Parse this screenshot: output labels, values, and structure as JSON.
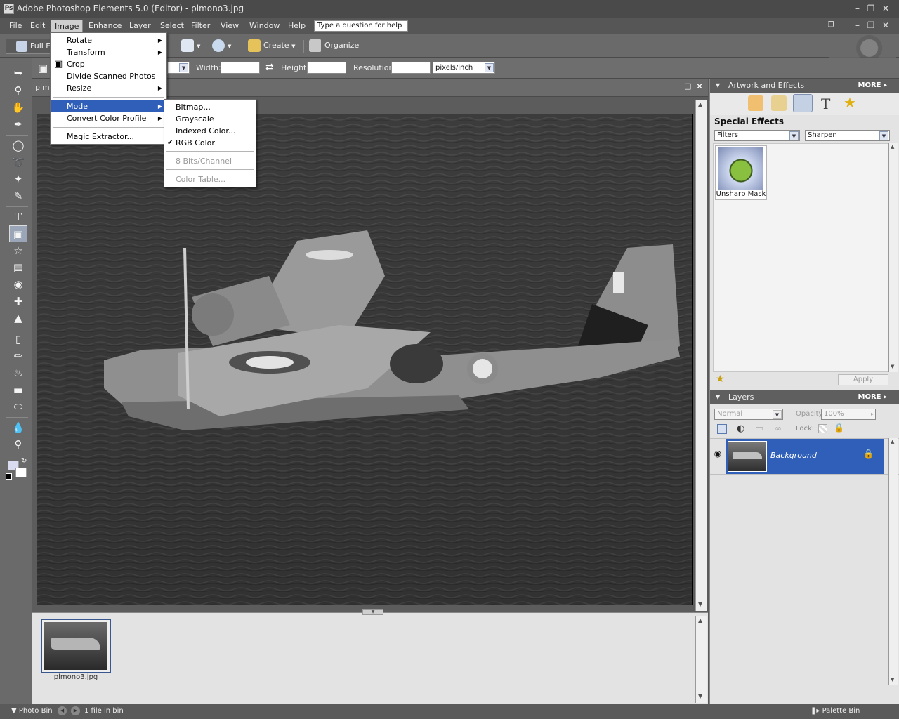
{
  "window": {
    "title": "Adobe Photoshop Elements 5.0 (Editor) - plmono3.jpg",
    "icon_label": "Ps"
  },
  "menubar": {
    "items": [
      "File",
      "Edit",
      "Image",
      "Enhance",
      "Layer",
      "Select",
      "Filter",
      "View",
      "Window",
      "Help"
    ],
    "help_placeholder": "Type a question for help"
  },
  "shortcuts": {
    "full_edit": "Full E",
    "create": "Create",
    "organize": "Organize"
  },
  "options": {
    "width_label": "Width:",
    "height_label": "Height:",
    "resolution_label": "Resolution:",
    "units": "pixels/inch",
    "doc_name_fragment": "plm"
  },
  "image_menu": {
    "items": [
      "Rotate",
      "Transform",
      "Crop",
      "Divide Scanned Photos",
      "Resize",
      "Mode",
      "Convert Color Profile",
      "Magic Extractor..."
    ]
  },
  "mode_submenu": {
    "items": [
      "Bitmap...",
      "Grayscale",
      "Indexed Color...",
      "RGB Color",
      "8 Bits/Channel",
      "Color Table..."
    ],
    "checked": "RGB Color"
  },
  "artwork": {
    "title": "Artwork and Effects",
    "more": "MORE",
    "section": "Special Effects",
    "filter_select": "Filters",
    "category_select": "Sharpen",
    "thumb_label": "Unsharp Mask",
    "apply_label": "Apply"
  },
  "layers": {
    "title": "Layers",
    "more": "MORE",
    "blend_mode": "Normal",
    "opacity_label": "Opacity:",
    "opacity_value": "100%",
    "lock_label": "Lock:",
    "layer_name": "Background"
  },
  "photobin": {
    "file_name": "plmono3.jpg"
  },
  "status": {
    "photo_bin": "Photo Bin",
    "count": "1 file in bin",
    "palette_bin": "Palette Bin"
  }
}
